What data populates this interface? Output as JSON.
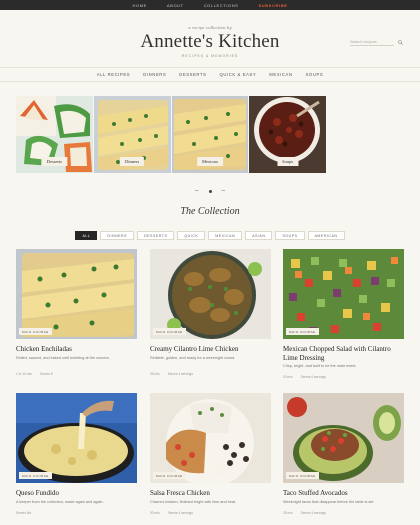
{
  "topnav": [
    "HOME",
    "ABOUT",
    "COLLECTIONS",
    "SUBSCRIBE"
  ],
  "header": {
    "tagline": "a recipe collection by",
    "title": "Annette's Kitchen",
    "subtitle": "RECIPES & MEMORIES",
    "search_placeholder": "Search recipes"
  },
  "nav": [
    "ALL RECIPES",
    "DINNERS",
    "DESSERTS",
    "QUICK & EASY",
    "MEXICAN",
    "SOUPS"
  ],
  "strip": [
    {
      "label": "Desserts",
      "icon": "cookie-photo"
    },
    {
      "label": "Dinners",
      "icon": "enchilada-photo"
    },
    {
      "label": "Mexican",
      "icon": "enchilada-photo"
    },
    {
      "label": "Soups",
      "icon": "chili-bowl-photo"
    }
  ],
  "carousel": {
    "prev": "–",
    "next": "–"
  },
  "collection": {
    "title": "The Collection",
    "filters": [
      "ALL",
      "DINNERS",
      "DESSERTS",
      "QUICK",
      "MEXICAN",
      "ASIAN",
      "SOUPS",
      "AMERICAN"
    ],
    "active_filter": "ALL"
  },
  "cards": [
    {
      "badge": "MAIN COURSE",
      "title": "Chicken Enchiladas",
      "desc": "Rolled, sauced, and baked until bubbling at the corners.",
      "time": "1 hr 10 min",
      "serves": "Serves 8"
    },
    {
      "badge": "MAIN COURSE",
      "title": "Creamy Cilantro Lime Chicken",
      "desc": "Reliable, golden, and ready for a weeknight crowd.",
      "time": "35 min",
      "serves": "Serves 4 servings"
    },
    {
      "badge": "MAIN COURSE",
      "title": "Mexican Chopped Salad with Cilantro Lime Dressing",
      "desc": "Crisp, bright, and built to be the main event.",
      "time": "20 min",
      "serves": "Serves 6 servings"
    },
    {
      "badge": "MAIN COURSE",
      "title": "Queso Fundido",
      "desc": "A keeper from the collection, made again and again.",
      "time": "Serves 6m",
      "serves": ""
    },
    {
      "badge": "MAIN COURSE",
      "title": "Salsa Fresca Chicken",
      "desc": "Charred chicken, finished bright with lime and heat.",
      "time": "30 min",
      "serves": "Serves 4 servings"
    },
    {
      "badge": "MAIN COURSE",
      "title": "Taco Stuffed Avocados",
      "desc": "Weeknight tacos that disappear before the table is set.",
      "time": "25 min",
      "serves": "Serves 4 servings"
    }
  ],
  "colors": {
    "accent": "#e3603a",
    "topbar": "#2b2b2b",
    "bg": "#f8f6f1"
  }
}
